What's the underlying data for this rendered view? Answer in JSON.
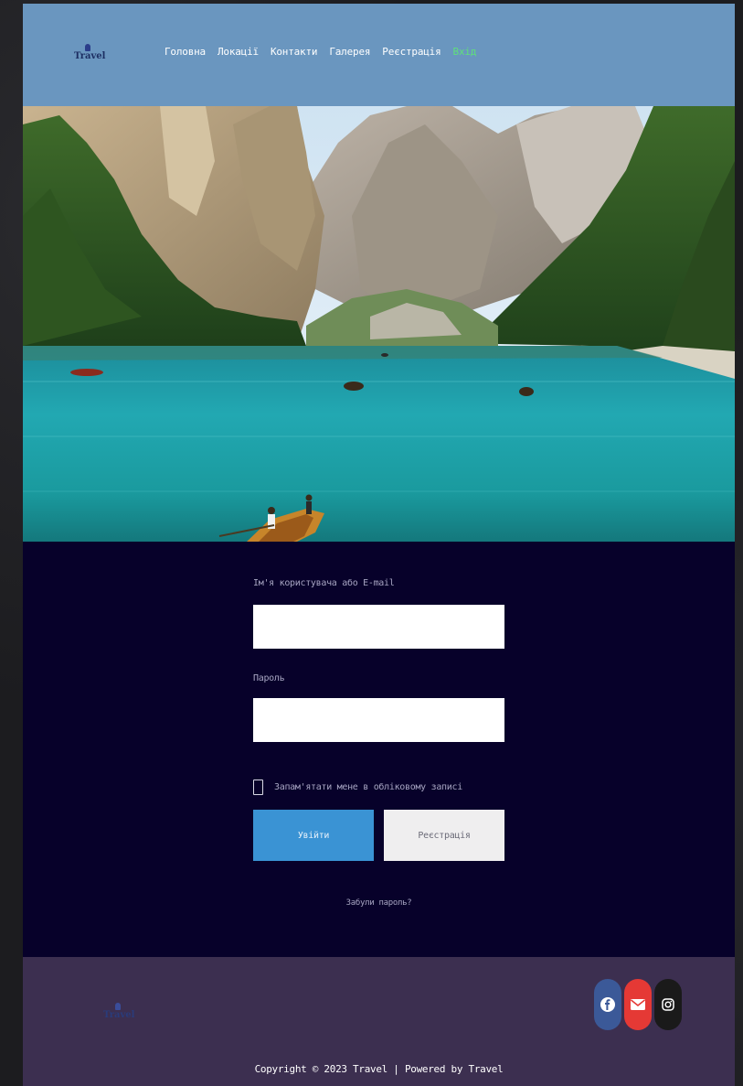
{
  "header": {
    "logo_text": "Travel",
    "nav": [
      {
        "label": "Головна"
      },
      {
        "label": "Локації"
      },
      {
        "label": "Контакти"
      },
      {
        "label": "Галерея"
      },
      {
        "label": "Реєстрація"
      },
      {
        "label": "Вхід"
      }
    ],
    "active_color": "#5fe07a",
    "background": "#6a96bf"
  },
  "login": {
    "username_label": "Ім'я користувача або E-mail",
    "username_value": "",
    "password_label": "Пароль",
    "password_value": "",
    "remember_label": "Запам'ятати мене в обліковому записі",
    "login_button": "Увійти",
    "register_button": "Реєстрація",
    "forgot_link": "Забули пароль?",
    "background": "#07012a",
    "accent": "#3a93d4"
  },
  "footer": {
    "logo_text": "Travel",
    "social": [
      {
        "icon": "facebook-icon",
        "color": "#3b5998"
      },
      {
        "icon": "envelope-icon",
        "color": "#e53935"
      },
      {
        "icon": "instagram-icon",
        "color": "#1a1a1a"
      }
    ],
    "copyright": "Copyright © 2023 Travel | Powered by Travel",
    "background": "#3c2f50"
  }
}
